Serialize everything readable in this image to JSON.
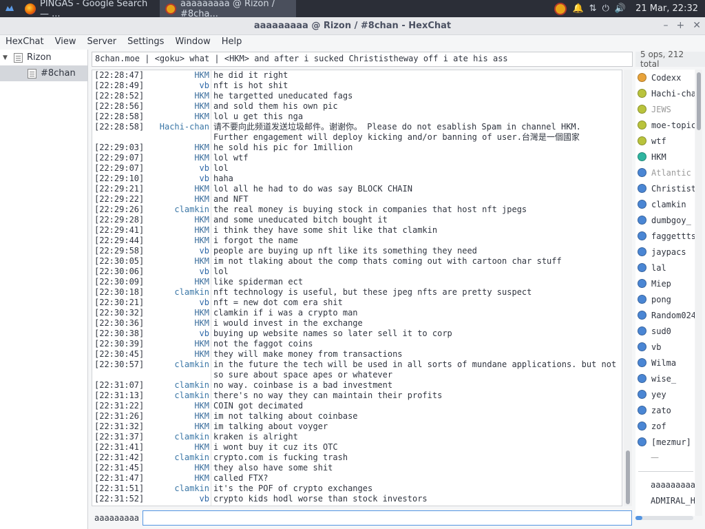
{
  "taskbar": {
    "tasks": [
      {
        "label": "PINGAS - Google Search — ...",
        "color": "#e66000"
      },
      {
        "label": "aaaaaaaaa @ Rizon / #8cha...",
        "color": "#e8a317"
      }
    ],
    "clock": "21 Mar, 22:32"
  },
  "window": {
    "title": "aaaaaaaaa @ Rizon / #8chan - HexChat"
  },
  "menu": [
    "HexChat",
    "View",
    "Server",
    "Settings",
    "Window",
    "Help"
  ],
  "tree": {
    "server": "Rizon",
    "channel": "#8chan"
  },
  "topic": "8chan.moe | <goku> what | <HKM> and after i sucked Christistheway off i ate his ass",
  "usercount": "5 ops, 212 total",
  "messages": [
    {
      "ts": "[22:28:47]",
      "nick": "HKM",
      "msg": "he did it right"
    },
    {
      "ts": "[22:28:49]",
      "nick": "vb",
      "msg": "nft is hot shit"
    },
    {
      "ts": "[22:28:52]",
      "nick": "HKM",
      "msg": "he targetted uneducated fags"
    },
    {
      "ts": "[22:28:56]",
      "nick": "HKM",
      "msg": "and sold them his own pic"
    },
    {
      "ts": "[22:28:58]",
      "nick": "HKM",
      "msg": "lol u get this nga"
    },
    {
      "ts": "[22:28:58]",
      "nick": "Hachi-chan",
      "msg": "请不要向此频道发送垃圾邮件。谢谢你。 Please do not esablish Spam in channel HKM. Further engagement will deploy kicking and/or banning of user.台灣是一個國家",
      "wrap": true
    },
    {
      "ts": "[22:29:03]",
      "nick": "HKM",
      "msg": "he sold his pic for 1million"
    },
    {
      "ts": "[22:29:07]",
      "nick": "HKM",
      "msg": "lol wtf"
    },
    {
      "ts": "[22:29:07]",
      "nick": "vb",
      "msg": "lol"
    },
    {
      "ts": "[22:29:10]",
      "nick": "vb",
      "msg": "haha"
    },
    {
      "ts": "[22:29:21]",
      "nick": "HKM",
      "msg": "lol all he had to do was say BLOCK CHAIN"
    },
    {
      "ts": "[22:29:22]",
      "nick": "HKM",
      "msg": "and NFT"
    },
    {
      "ts": "[22:29:26]",
      "nick": "clamkin",
      "msg": "the real money is buying stock in companies that host nft jpegs"
    },
    {
      "ts": "[22:29:28]",
      "nick": "HKM",
      "msg": "and some uneducated bitch bought it"
    },
    {
      "ts": "[22:29:41]",
      "nick": "HKM",
      "msg": "i think they have some shit like that clamkin"
    },
    {
      "ts": "[22:29:44]",
      "nick": "HKM",
      "msg": "i forgot the name"
    },
    {
      "ts": "[22:29:58]",
      "nick": "vb",
      "msg": "people are buying up nft like its something they need"
    },
    {
      "ts": "[22:30:05]",
      "nick": "HKM",
      "msg": "im not tlaking about the comp thats coming out with cartoon char stuff"
    },
    {
      "ts": "[22:30:06]",
      "nick": "vb",
      "msg": "lol"
    },
    {
      "ts": "[22:30:09]",
      "nick": "HKM",
      "msg": "like spiderman ect"
    },
    {
      "ts": "[22:30:18]",
      "nick": "clamkin",
      "msg": "nft technology is useful, but these jpeg nfts are pretty suspect"
    },
    {
      "ts": "[22:30:21]",
      "nick": "vb",
      "msg": "nft = new dot com era shit"
    },
    {
      "ts": "[22:30:32]",
      "nick": "HKM",
      "msg": "clamkin if i was a crypto man"
    },
    {
      "ts": "[22:30:36]",
      "nick": "HKM",
      "msg": "i would invest in the exchange"
    },
    {
      "ts": "[22:30:38]",
      "nick": "vb",
      "msg": "buying up website names so later sell it to corp"
    },
    {
      "ts": "[22:30:39]",
      "nick": "HKM",
      "msg": "not the faggot coins"
    },
    {
      "ts": "[22:30:45]",
      "nick": "HKM",
      "msg": "they will make money from transactions"
    },
    {
      "ts": "[22:30:57]",
      "nick": "clamkin",
      "msg": "in the future the tech will be used in all sorts of mundane applications. but not so sure about space apes or whatever",
      "wrap": true
    },
    {
      "ts": "[22:31:07]",
      "nick": "clamkin",
      "msg": "no way. coinbase is a bad investment"
    },
    {
      "ts": "[22:31:13]",
      "nick": "clamkin",
      "msg": "there's no way they can maintain their profits"
    },
    {
      "ts": "[22:31:22]",
      "nick": "HKM",
      "msg": "COIN got decimated"
    },
    {
      "ts": "[22:31:26]",
      "nick": "HKM",
      "msg": "im not talking about coinbase"
    },
    {
      "ts": "[22:31:32]",
      "nick": "HKM",
      "msg": "im talking about voyger"
    },
    {
      "ts": "[22:31:37]",
      "nick": "clamkin",
      "msg": "kraken is alright"
    },
    {
      "ts": "[22:31:41]",
      "nick": "HKM",
      "msg": "i wont buy it cuz its OTC"
    },
    {
      "ts": "[22:31:42]",
      "nick": "clamkin",
      "msg": "crypto.com is fucking trash"
    },
    {
      "ts": "[22:31:45]",
      "nick": "HKM",
      "msg": "they also have some shit"
    },
    {
      "ts": "[22:31:47]",
      "nick": "HKM",
      "msg": "called FTX?"
    },
    {
      "ts": "[22:31:51]",
      "nick": "clamkin",
      "msg": "it's the POF of crypto exchanges"
    },
    {
      "ts": "[22:31:52]",
      "nick": "vb",
      "msg": "crypto kids hodl worse than stock investors"
    }
  ],
  "users": [
    {
      "name": "Codexx",
      "color": "#e8a33a"
    },
    {
      "name": "Hachi-chan",
      "color": "#b9c33c"
    },
    {
      "name": "JEWS",
      "color": "#b9c33c",
      "away": true
    },
    {
      "name": "moe-topic",
      "color": "#b9c33c"
    },
    {
      "name": "wtf",
      "color": "#b9c33c"
    },
    {
      "name": "HKM",
      "color": "#2fb5a0"
    },
    {
      "name": "Atlantic",
      "color": "#4a86d4",
      "away": true
    },
    {
      "name": "Christist",
      "color": "#4a86d4"
    },
    {
      "name": "clamkin",
      "color": "#4a86d4"
    },
    {
      "name": "dumbgoy_",
      "color": "#4a86d4"
    },
    {
      "name": "faggettts",
      "color": "#4a86d4"
    },
    {
      "name": "jaypacs",
      "color": "#4a86d4"
    },
    {
      "name": "lal",
      "color": "#4a86d4"
    },
    {
      "name": "Miep",
      "color": "#4a86d4"
    },
    {
      "name": "pong",
      "color": "#4a86d4"
    },
    {
      "name": "Random024",
      "color": "#4a86d4"
    },
    {
      "name": "sud0",
      "color": "#4a86d4"
    },
    {
      "name": "vb",
      "color": "#4a86d4"
    },
    {
      "name": "Wilma",
      "color": "#4a86d4"
    },
    {
      "name": "wise_",
      "color": "#4a86d4"
    },
    {
      "name": "yey",
      "color": "#4a86d4"
    },
    {
      "name": "zato",
      "color": "#4a86d4"
    },
    {
      "name": "zof",
      "color": "#4a86d4"
    },
    {
      "name": "[mezmur]",
      "color": "#4a86d4"
    }
  ],
  "userlist_dash": "—",
  "userlist_plain": [
    "aaaaaaaaa",
    "ADMIRAL_H"
  ],
  "input": {
    "nick": "aaaaaaaaa",
    "value": ""
  },
  "colors": {
    "accent": "#5294e2"
  }
}
